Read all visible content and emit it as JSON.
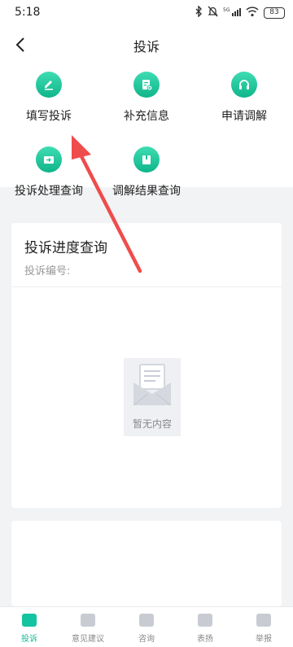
{
  "status_bar": {
    "time": "5:18",
    "network": "5G",
    "battery": "83"
  },
  "header": {
    "title": "投诉",
    "back_icon": "chevron-left-icon"
  },
  "services": [
    {
      "label": "填写投诉",
      "icon": "edit-pen-icon"
    },
    {
      "label": "补充信息",
      "icon": "document-add-icon"
    },
    {
      "label": "申请调解",
      "icon": "headset-icon"
    },
    {
      "label": "投诉处理查询",
      "icon": "folder-arrow-icon"
    },
    {
      "label": "调解结果查询",
      "icon": "book-icon"
    }
  ],
  "progress_card": {
    "title": "投诉进度查询",
    "subtitle": "投诉编号:",
    "empty_text": "暂无内容"
  },
  "bottom_nav": [
    {
      "label": "投诉",
      "active": true
    },
    {
      "label": "意见建议",
      "active": false
    },
    {
      "label": "咨询",
      "active": false
    },
    {
      "label": "表扬",
      "active": false
    },
    {
      "label": "举报",
      "active": false
    }
  ],
  "colors": {
    "accent": "#14c4a0",
    "annotation_arrow": "#ef4c4c"
  }
}
